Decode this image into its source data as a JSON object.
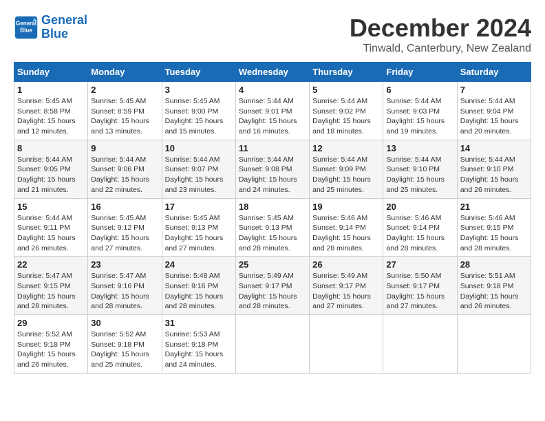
{
  "logo": {
    "line1": "General",
    "line2": "Blue"
  },
  "title": "December 2024",
  "location": "Tinwald, Canterbury, New Zealand",
  "days_of_week": [
    "Sunday",
    "Monday",
    "Tuesday",
    "Wednesday",
    "Thursday",
    "Friday",
    "Saturday"
  ],
  "weeks": [
    [
      {
        "day": "1",
        "info": "Sunrise: 5:45 AM\nSunset: 8:58 PM\nDaylight: 15 hours\nand 12 minutes."
      },
      {
        "day": "2",
        "info": "Sunrise: 5:45 AM\nSunset: 8:59 PM\nDaylight: 15 hours\nand 13 minutes."
      },
      {
        "day": "3",
        "info": "Sunrise: 5:45 AM\nSunset: 9:00 PM\nDaylight: 15 hours\nand 15 minutes."
      },
      {
        "day": "4",
        "info": "Sunrise: 5:44 AM\nSunset: 9:01 PM\nDaylight: 15 hours\nand 16 minutes."
      },
      {
        "day": "5",
        "info": "Sunrise: 5:44 AM\nSunset: 9:02 PM\nDaylight: 15 hours\nand 18 minutes."
      },
      {
        "day": "6",
        "info": "Sunrise: 5:44 AM\nSunset: 9:03 PM\nDaylight: 15 hours\nand 19 minutes."
      },
      {
        "day": "7",
        "info": "Sunrise: 5:44 AM\nSunset: 9:04 PM\nDaylight: 15 hours\nand 20 minutes."
      }
    ],
    [
      {
        "day": "8",
        "info": "Sunrise: 5:44 AM\nSunset: 9:05 PM\nDaylight: 15 hours\nand 21 minutes."
      },
      {
        "day": "9",
        "info": "Sunrise: 5:44 AM\nSunset: 9:06 PM\nDaylight: 15 hours\nand 22 minutes."
      },
      {
        "day": "10",
        "info": "Sunrise: 5:44 AM\nSunset: 9:07 PM\nDaylight: 15 hours\nand 23 minutes."
      },
      {
        "day": "11",
        "info": "Sunrise: 5:44 AM\nSunset: 9:08 PM\nDaylight: 15 hours\nand 24 minutes."
      },
      {
        "day": "12",
        "info": "Sunrise: 5:44 AM\nSunset: 9:09 PM\nDaylight: 15 hours\nand 25 minutes."
      },
      {
        "day": "13",
        "info": "Sunrise: 5:44 AM\nSunset: 9:10 PM\nDaylight: 15 hours\nand 25 minutes."
      },
      {
        "day": "14",
        "info": "Sunrise: 5:44 AM\nSunset: 9:10 PM\nDaylight: 15 hours\nand 26 minutes."
      }
    ],
    [
      {
        "day": "15",
        "info": "Sunrise: 5:44 AM\nSunset: 9:11 PM\nDaylight: 15 hours\nand 26 minutes."
      },
      {
        "day": "16",
        "info": "Sunrise: 5:45 AM\nSunset: 9:12 PM\nDaylight: 15 hours\nand 27 minutes."
      },
      {
        "day": "17",
        "info": "Sunrise: 5:45 AM\nSunset: 9:13 PM\nDaylight: 15 hours\nand 27 minutes."
      },
      {
        "day": "18",
        "info": "Sunrise: 5:45 AM\nSunset: 9:13 PM\nDaylight: 15 hours\nand 28 minutes."
      },
      {
        "day": "19",
        "info": "Sunrise: 5:46 AM\nSunset: 9:14 PM\nDaylight: 15 hours\nand 28 minutes."
      },
      {
        "day": "20",
        "info": "Sunrise: 5:46 AM\nSunset: 9:14 PM\nDaylight: 15 hours\nand 28 minutes."
      },
      {
        "day": "21",
        "info": "Sunrise: 5:46 AM\nSunset: 9:15 PM\nDaylight: 15 hours\nand 28 minutes."
      }
    ],
    [
      {
        "day": "22",
        "info": "Sunrise: 5:47 AM\nSunset: 9:15 PM\nDaylight: 15 hours\nand 28 minutes."
      },
      {
        "day": "23",
        "info": "Sunrise: 5:47 AM\nSunset: 9:16 PM\nDaylight: 15 hours\nand 28 minutes."
      },
      {
        "day": "24",
        "info": "Sunrise: 5:48 AM\nSunset: 9:16 PM\nDaylight: 15 hours\nand 28 minutes."
      },
      {
        "day": "25",
        "info": "Sunrise: 5:49 AM\nSunset: 9:17 PM\nDaylight: 15 hours\nand 28 minutes."
      },
      {
        "day": "26",
        "info": "Sunrise: 5:49 AM\nSunset: 9:17 PM\nDaylight: 15 hours\nand 27 minutes."
      },
      {
        "day": "27",
        "info": "Sunrise: 5:50 AM\nSunset: 9:17 PM\nDaylight: 15 hours\nand 27 minutes."
      },
      {
        "day": "28",
        "info": "Sunrise: 5:51 AM\nSunset: 9:18 PM\nDaylight: 15 hours\nand 26 minutes."
      }
    ],
    [
      {
        "day": "29",
        "info": "Sunrise: 5:52 AM\nSunset: 9:18 PM\nDaylight: 15 hours\nand 26 minutes."
      },
      {
        "day": "30",
        "info": "Sunrise: 5:52 AM\nSunset: 9:18 PM\nDaylight: 15 hours\nand 25 minutes."
      },
      {
        "day": "31",
        "info": "Sunrise: 5:53 AM\nSunset: 9:18 PM\nDaylight: 15 hours\nand 24 minutes."
      },
      {
        "day": "",
        "info": ""
      },
      {
        "day": "",
        "info": ""
      },
      {
        "day": "",
        "info": ""
      },
      {
        "day": "",
        "info": ""
      }
    ]
  ]
}
